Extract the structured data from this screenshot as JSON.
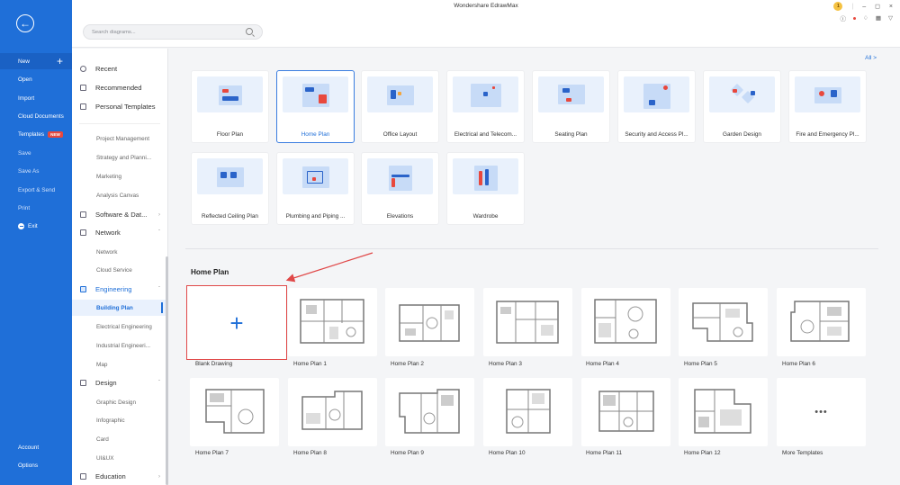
{
  "window": {
    "title": "Wondershare EdrawMax"
  },
  "topbar": {
    "search_placeholder": "Search diagrams...",
    "icons": [
      "user-avatar-icon",
      "minimize-icon",
      "maximize-icon",
      "close-icon",
      "help-icon",
      "bell-icon",
      "apps-icon",
      "shirt-icon"
    ]
  },
  "leftbar": {
    "items": [
      {
        "label": "New"
      },
      {
        "label": "Open"
      },
      {
        "label": "Import"
      },
      {
        "label": "Cloud Documents"
      },
      {
        "label": "Templates",
        "badge": "NEW"
      },
      {
        "label": "Save"
      },
      {
        "label": "Save As"
      },
      {
        "label": "Export & Send"
      },
      {
        "label": "Print"
      },
      {
        "label": "Exit"
      },
      {
        "label": "Account"
      },
      {
        "label": "Options"
      }
    ]
  },
  "catnav": {
    "top": [
      {
        "label": "Recent"
      },
      {
        "label": "Recommended"
      },
      {
        "label": "Personal Templates"
      }
    ],
    "subs_top": [
      "Project Management",
      "Strategy and Planni...",
      "Marketing",
      "Analysis Canvas"
    ],
    "software": "Software & Dat...",
    "network": "Network",
    "network_subs": [
      "Network",
      "Cloud Service"
    ],
    "engineering": "Engineering",
    "engineering_subs": [
      "Building Plan",
      "Electrical Engineering",
      "Industrial Engineeri...",
      "Map"
    ],
    "design": "Design",
    "design_subs": [
      "Graphic Design",
      "Infographic",
      "Card",
      "UI&UX"
    ],
    "education": "Education"
  },
  "main": {
    "all_link": "All  >",
    "types": [
      "Floor Plan",
      "Home Plan",
      "Office Layout",
      "Electrical and Telecom...",
      "Seating Plan",
      "Security and Access Pl...",
      "Garden Design",
      "Fire and Emergency Pl...",
      "Reflected Ceiling Plan",
      "Plumbing and Piping ...",
      "Elevations",
      "Wardrobe"
    ],
    "selected_type": "Home Plan",
    "section_title": "Home Plan",
    "templates": [
      "Blank Drawing",
      "Home Plan 1",
      "Home Plan 2",
      "Home Plan 3",
      "Home Plan 4",
      "Home Plan 5",
      "Home Plan 6",
      "Home Plan 7",
      "Home Plan 8",
      "Home Plan 9",
      "Home Plan 10",
      "Home Plan 11",
      "Home Plan 12",
      "More Templates"
    ],
    "more_glyph": "•••"
  },
  "colors": {
    "accent": "#1f6fd8",
    "annotation": "#e04848"
  }
}
